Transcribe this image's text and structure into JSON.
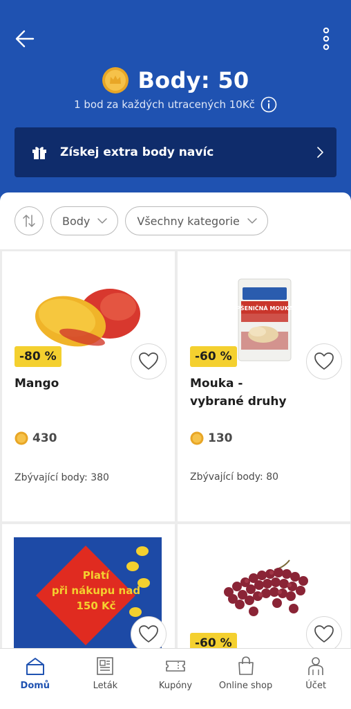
{
  "header": {
    "back_icon": "arrow-left-icon",
    "more_icon": "more-vertical-icon",
    "points_title": "Body: 50",
    "points_subtitle": "1 bod za každých utracených 10Kč",
    "info_icon": "info-icon",
    "extra_banner": {
      "label": "Získej extra body navíc",
      "icon": "gift-icon"
    }
  },
  "filters": {
    "sort_icon": "sort-arrows-icon",
    "chips": [
      {
        "label": "Body"
      },
      {
        "label": "Všechny kategorie"
      }
    ]
  },
  "products": [
    {
      "discount": "-80 %",
      "name": "Mango",
      "cost": "430",
      "remaining": "Zbývající body: 380"
    },
    {
      "discount": "-60 %",
      "name_line1": "Mouka -",
      "name_line2": "vybrané druhy",
      "cost": "130",
      "remaining": "Zbývající body: 80"
    },
    {
      "promo_line1": "Platí",
      "promo_line2": "při nákupu nad",
      "promo_line3": "150 Kč"
    },
    {
      "discount": "-60 %"
    }
  ],
  "nav": {
    "items": [
      {
        "label": "Domů",
        "icon": "home-icon",
        "active": true
      },
      {
        "label": "Leták",
        "icon": "leaflet-icon"
      },
      {
        "label": "Kupóny",
        "icon": "coupon-icon"
      },
      {
        "label": "Online shop",
        "icon": "shopping-bag-icon"
      },
      {
        "label": "Účet",
        "icon": "user-icon"
      }
    ]
  },
  "colors": {
    "brand_blue": "#1f52b1",
    "banner_navy": "#0f2c6b",
    "discount_yellow": "#f4d02f",
    "coin_gold": "#e8a626"
  }
}
